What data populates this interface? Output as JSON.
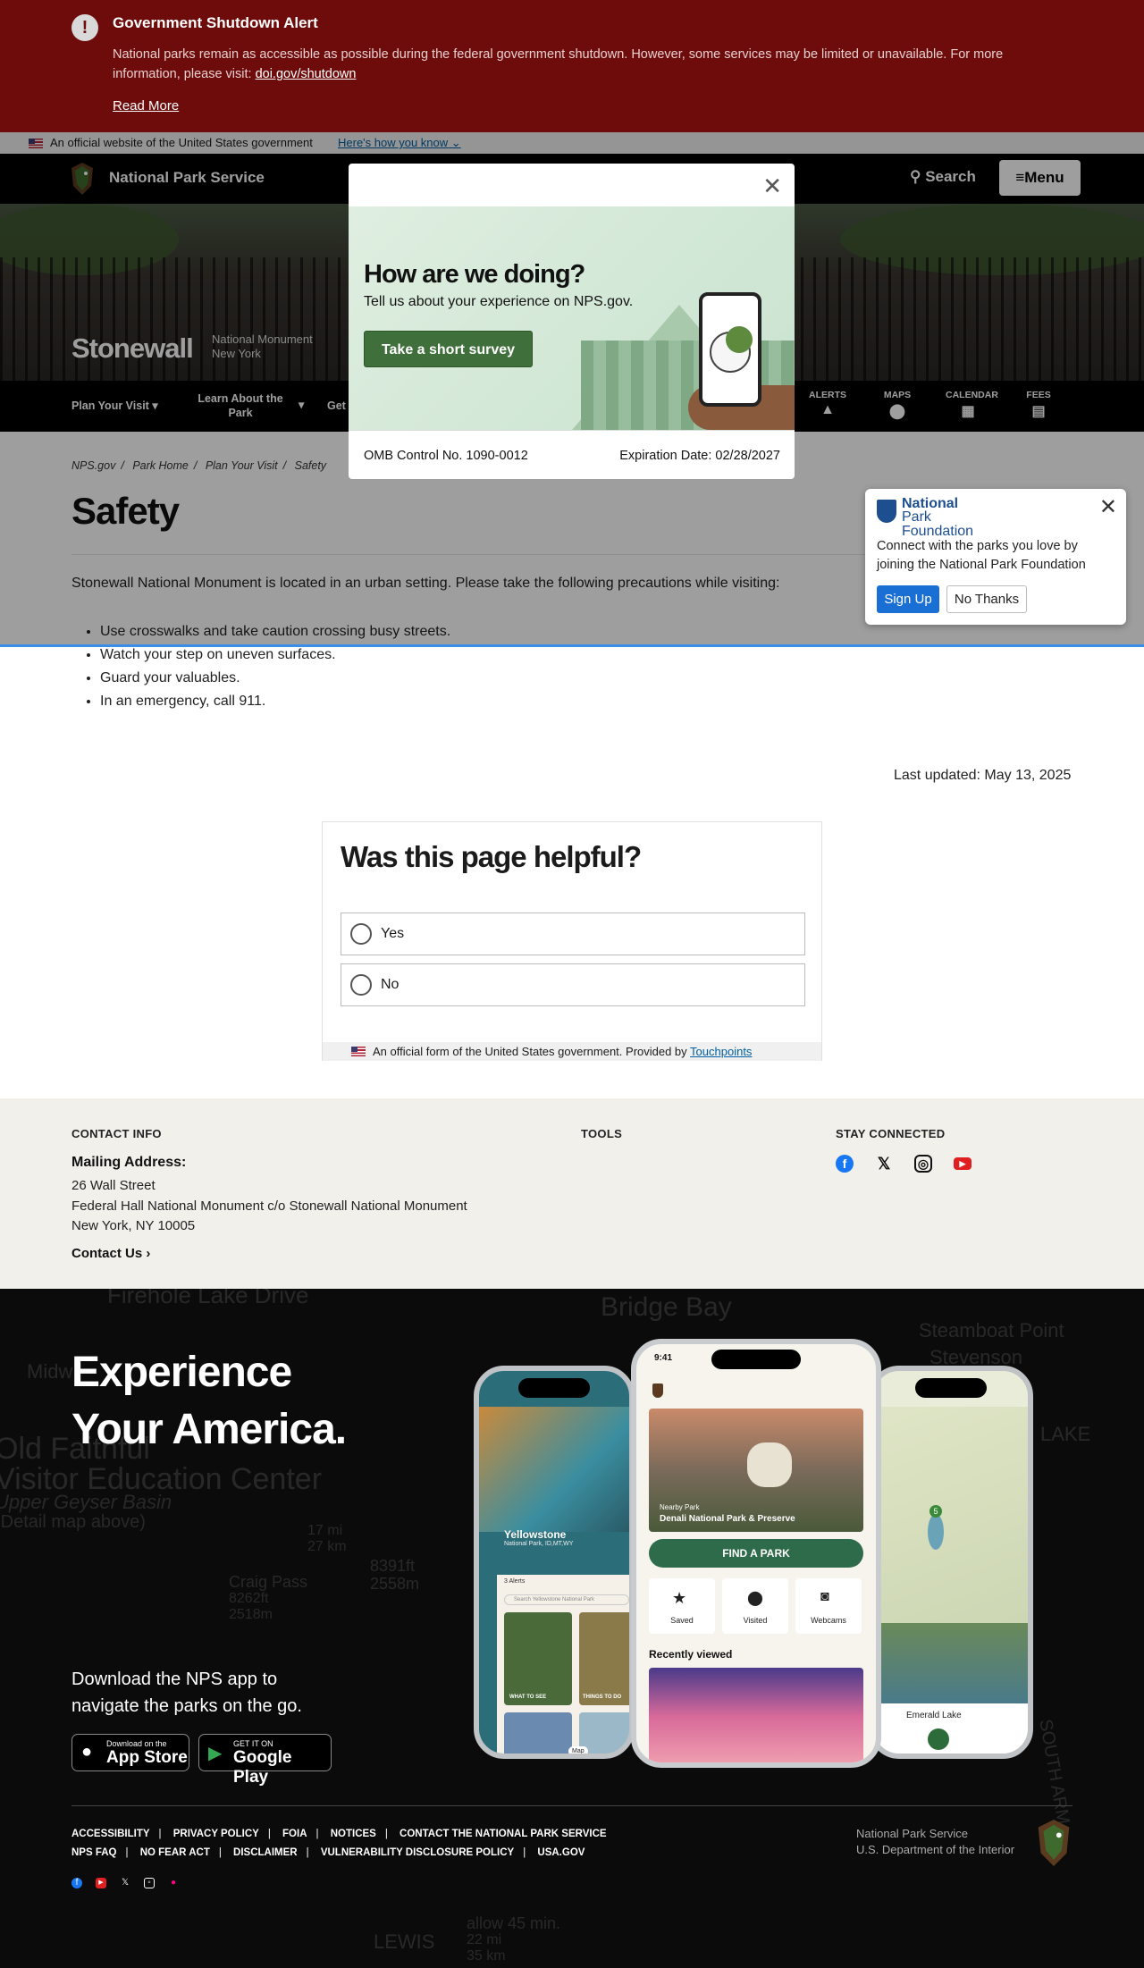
{
  "alert": {
    "title": "Government Shutdown Alert",
    "body": "National parks remain as accessible as possible during the federal government shutdown. However, some services may be limited or unavailable. For more information, please visit: ",
    "link": "doi.gov/shutdown",
    "read_more": "Read More"
  },
  "gov_banner": {
    "text": "An official website of the United States government",
    "link": "Here's how you know"
  },
  "header": {
    "brand": "National Park Service",
    "search": "Search",
    "menu": "Menu"
  },
  "park": {
    "name": "Stonewall",
    "designation": "National Monument",
    "state": "New York"
  },
  "park_nav": {
    "items": [
      "Plan Your Visit",
      "Learn About the Park",
      "Get"
    ],
    "quick": [
      "ALERTS",
      "MAPS",
      "CALENDAR",
      "FEES"
    ]
  },
  "breadcrumb": [
    "NPS.gov",
    "Park Home",
    "Plan Your Visit",
    "Safety"
  ],
  "page": {
    "title": "Safety",
    "intro": "Stonewall National Monument is located in an urban setting. Please take the following precautions while visiting:",
    "tips": [
      "Use crosswalks and take caution crossing busy streets.",
      "Watch your step on uneven surfaces.",
      "Guard your valuables.",
      "In an emergency, call 911."
    ],
    "last_updated": "Last updated: May 13, 2025"
  },
  "survey_modal": {
    "title": "How are we doing?",
    "subtitle": "Tell us about your experience on NPS.gov.",
    "button": "Take a short survey",
    "omb": "OMB Control No. 1090-0012",
    "expiration": "Expiration Date: 02/28/2027"
  },
  "npf_popup": {
    "logo_line1": "National",
    "logo_line2": "Park Foundation",
    "text": "Connect with the parks you love by joining the National Park Foundation",
    "sign_up": "Sign Up",
    "no_thanks": "No Thanks"
  },
  "feedback": {
    "title": "Was this page helpful?",
    "yes": "Yes",
    "no": "No",
    "footer": "An official form of the United States government. Provided by ",
    "footer_link": "Touchpoints"
  },
  "contact": {
    "heading": "CONTACT INFO",
    "mailing_label": "Mailing Address:",
    "address": [
      "26 Wall Street",
      "Federal Hall National Monument c/o Stonewall National Monument",
      "New York, NY 10005"
    ],
    "contact_us": "Contact Us",
    "tools_heading": "TOOLS",
    "stay_heading": "STAY CONNECTED"
  },
  "app_promo": {
    "headline_1": "Experience",
    "headline_2": "Your America.",
    "download_1": "Download the NPS app to",
    "download_2": "navigate the parks on the go.",
    "appstore_small": "Download on the",
    "appstore_big": "App Store",
    "gplay_small": "GET IT ON",
    "gplay_big": "Google Play"
  },
  "phone_screens": {
    "left_title": "Yellowstone",
    "left_sub": "National Park, ID,MT,WY",
    "left_alerts": "3 Alerts",
    "left_search": "Search Yellowstone National Park",
    "left_tile1": "WHAT TO SEE",
    "left_tile2": "THINGS TO DO",
    "left_map": "Map",
    "center_time": "9:41",
    "center_nearby": "Nearby Park",
    "center_park": "Denali National Park & Preserve",
    "center_find": "FIND A PARK",
    "center_saved": "Saved",
    "center_visited": "Visited",
    "center_webcams": "Webcams",
    "center_recent": "Recently viewed",
    "right_lake": "Emerald Lake"
  },
  "footer_links": {
    "row1": [
      "ACCESSIBILITY",
      "PRIVACY POLICY",
      "FOIA",
      "NOTICES",
      "CONTACT THE NATIONAL PARK SERVICE"
    ],
    "row2": [
      "NPS FAQ",
      "NO FEAR ACT",
      "DISCLAIMER",
      "VULNERABILITY DISCLOSURE POLICY",
      "USA.GOV"
    ]
  },
  "footer_agency": {
    "line1": "National Park Service",
    "line2": "U.S. Department of the Interior"
  },
  "map_labels": [
    "Firehole Lake Drive",
    "Bridge Bay",
    "Steamboat Point",
    "Stevenson",
    "Midw",
    "Old Faithful",
    "Visitor Education Center",
    "Upper Geyser Basin",
    "(Detail map above)",
    "17 mi",
    "27 km",
    "8391ft",
    "2558m",
    "Craig Pass",
    "8262ft",
    "2518m",
    "LAKE",
    "SOUTH ARM",
    "allow 45 min.",
    "22 mi",
    "35 km",
    "LEWIS"
  ],
  "colors": {
    "alert_bg": "#6e0c0c",
    "nps_green": "#3f6f3a",
    "link_blue": "#005ea2",
    "npf_blue": "#1d4e8f"
  }
}
